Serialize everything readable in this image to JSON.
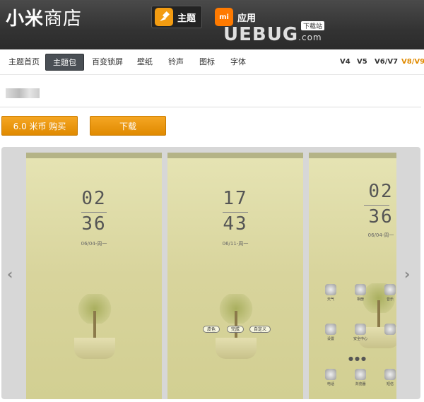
{
  "header": {
    "logo_bold": "小米",
    "logo_rest": "商店",
    "theme_label": "主题",
    "apps_label": "应用",
    "apps_icon_text": "mi",
    "watermark": "UEBUG",
    "watermark_suffix": ".com",
    "watermark_badge": "下载站"
  },
  "nav": {
    "items": [
      "主题首页",
      "主题包",
      "百变锁屏",
      "壁纸",
      "铃声",
      "图标",
      "字体"
    ],
    "active": "主题包",
    "versions": [
      "V4",
      "V5",
      "V6/V7",
      "V8/V9"
    ],
    "selected_version": "V8/V9"
  },
  "actions": {
    "buy_label": "6.0 米币 购买",
    "download_label": "下载"
  },
  "gallery": {
    "prev_icon": "chevron-left-icon",
    "next_icon": "chevron-right-icon",
    "shots": [
      {
        "hour": "02",
        "minute": "36",
        "date": "06/04-周一"
      },
      {
        "hour": "17",
        "minute": "43",
        "date": "06/11-周一",
        "buttons": [
          "皮色",
          "完成",
          "自定义"
        ]
      },
      {
        "hour": "02",
        "minute": "36",
        "date": "06/04-周一",
        "apps": [
          "天气",
          "相册",
          "音乐",
          "设置",
          "安全中心",
          "",
          "电话",
          "浏览器",
          "短信"
        ]
      }
    ]
  },
  "colors": {
    "accent": "#e08a00",
    "header_bg": "#333333",
    "active_tab": "#4a4f55"
  }
}
